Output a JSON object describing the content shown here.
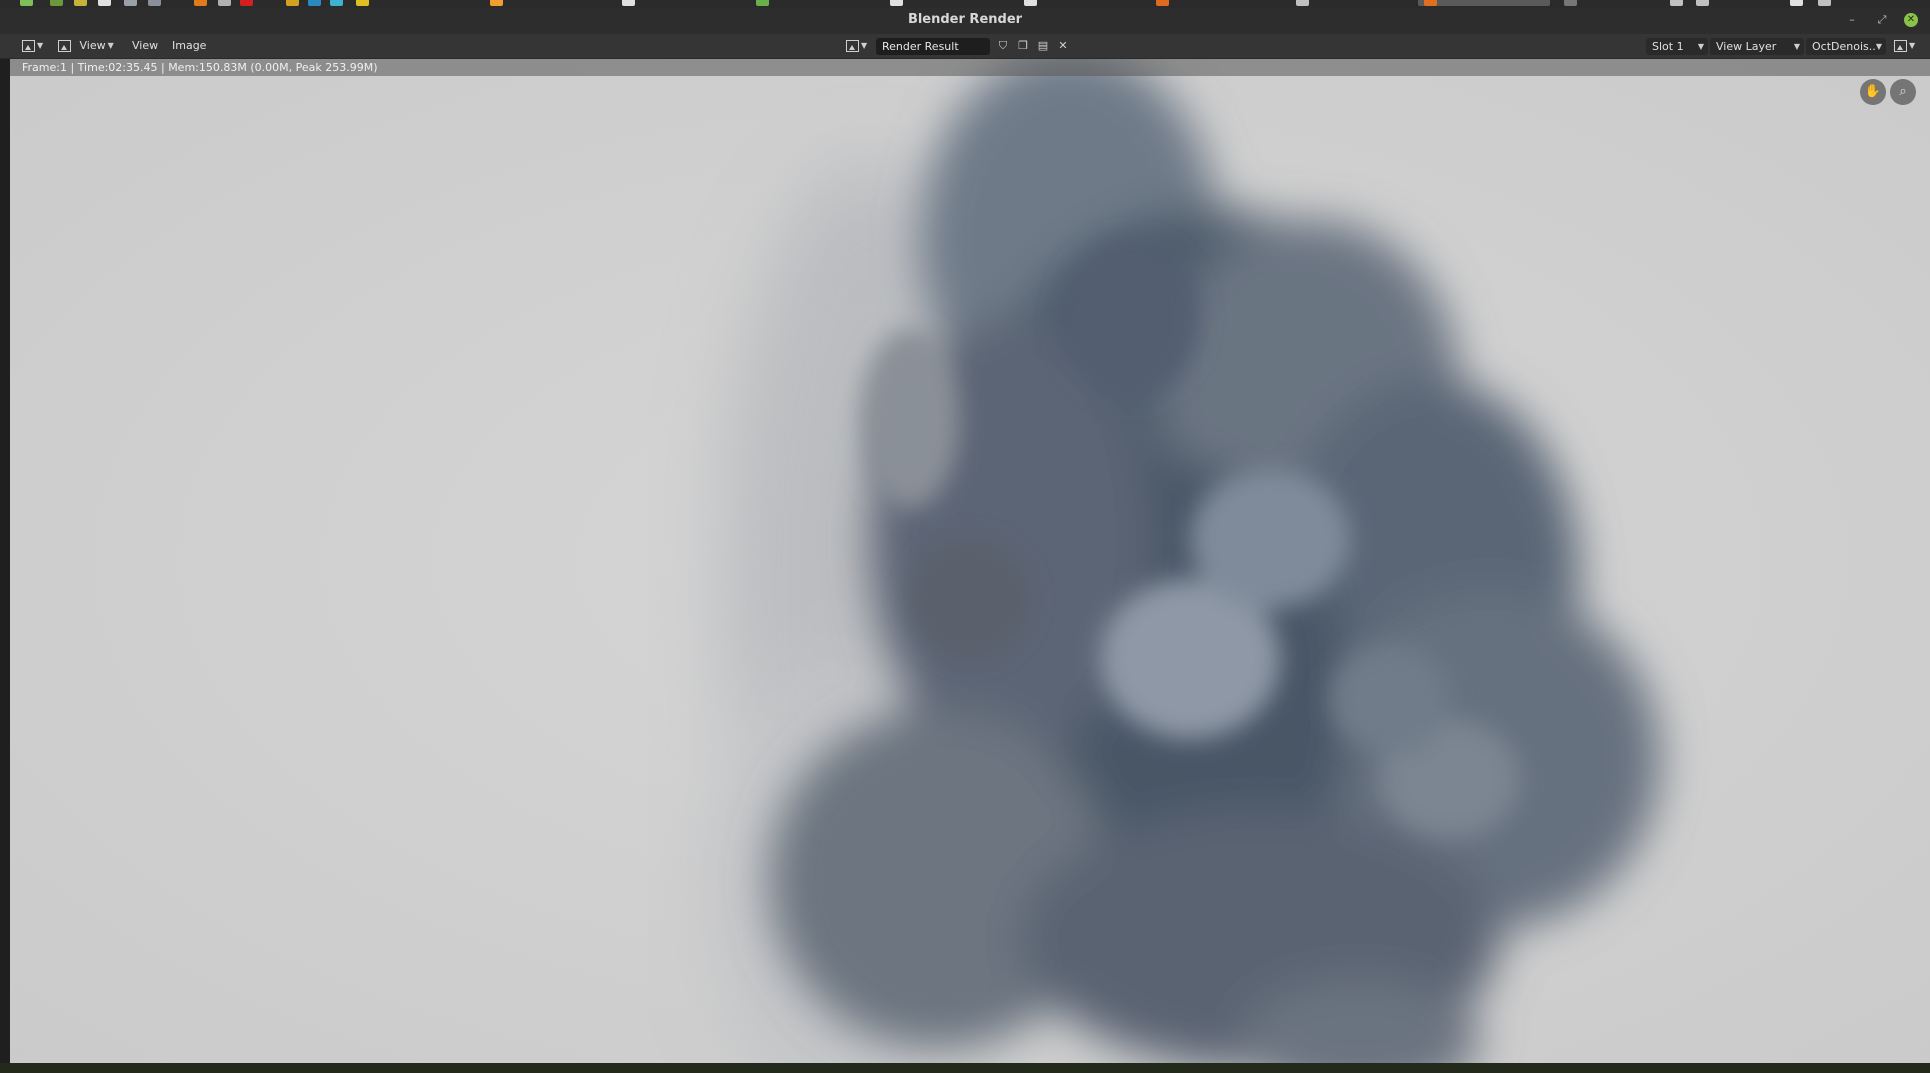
{
  "window": {
    "title": "Blender Render"
  },
  "window_controls": {
    "minimize": "–",
    "maximize": "⤢",
    "close": "✕"
  },
  "header": {
    "editor_type_icon": "image-editor-icon",
    "view_menu": "View",
    "view_menu2": "View",
    "image_menu": "Image",
    "image_name": "Render Result",
    "slot": "Slot 1",
    "view_layer": "View Layer",
    "render_pass": "OctDenois.."
  },
  "stats": {
    "text": "Frame:1 | Time:02:35.45 | Mem:150.83M (0.00M, Peak 253.99M)"
  },
  "gizmos": {
    "pan_icon": "hand-icon",
    "zoom_icon": "zoom-icon"
  },
  "colors": {
    "background": "#cfcfcf",
    "smoke_dark": "#4a5868",
    "smoke_light": "#9aa4b0",
    "header": "#353535",
    "accent_close": "#8bc34a"
  }
}
